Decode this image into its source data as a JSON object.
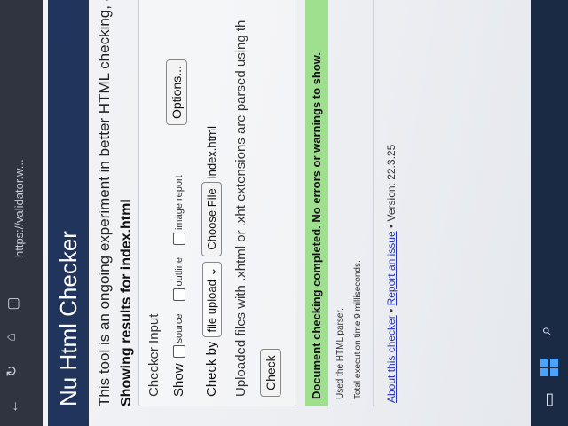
{
  "browser": {
    "url": "https://validator.w...",
    "icons": [
      "back-icon",
      "reload-icon",
      "home-icon",
      "tab-icon"
    ]
  },
  "taskbar": {
    "icons": [
      "windows-start-icon",
      "search-icon",
      "window-icon"
    ]
  },
  "page": {
    "title": "Nu Html Checker",
    "intro": "This tool is an ongoing experiment in better HTML checking, and it",
    "showing": "Showing results for index.html",
    "checker": {
      "legend": "Checker Input",
      "show_label": "Show",
      "options": [
        "source",
        "outline",
        "image report"
      ],
      "options_button": "Options...",
      "check_by_label": "Check by",
      "check_by_value": "file upload",
      "choose_file": "Choose File",
      "file_name": "index.html",
      "note": "Uploaded files with .xhtml or .xht extensions are parsed using th",
      "check_button": "Check"
    },
    "result": "Document checking completed. No errors or warnings to show.",
    "parser": "Used the HTML parser.",
    "exec_time": "Total execution time 9 milliseconds.",
    "footer": {
      "about": "About this checker",
      "sep1": " • ",
      "report": "Report an issue",
      "sep2": " • ",
      "version": "Version: 22.3.25"
    }
  },
  "colors": {
    "navbar": "#20345c",
    "success": "#9fe08f",
    "link": "#2833b8"
  }
}
